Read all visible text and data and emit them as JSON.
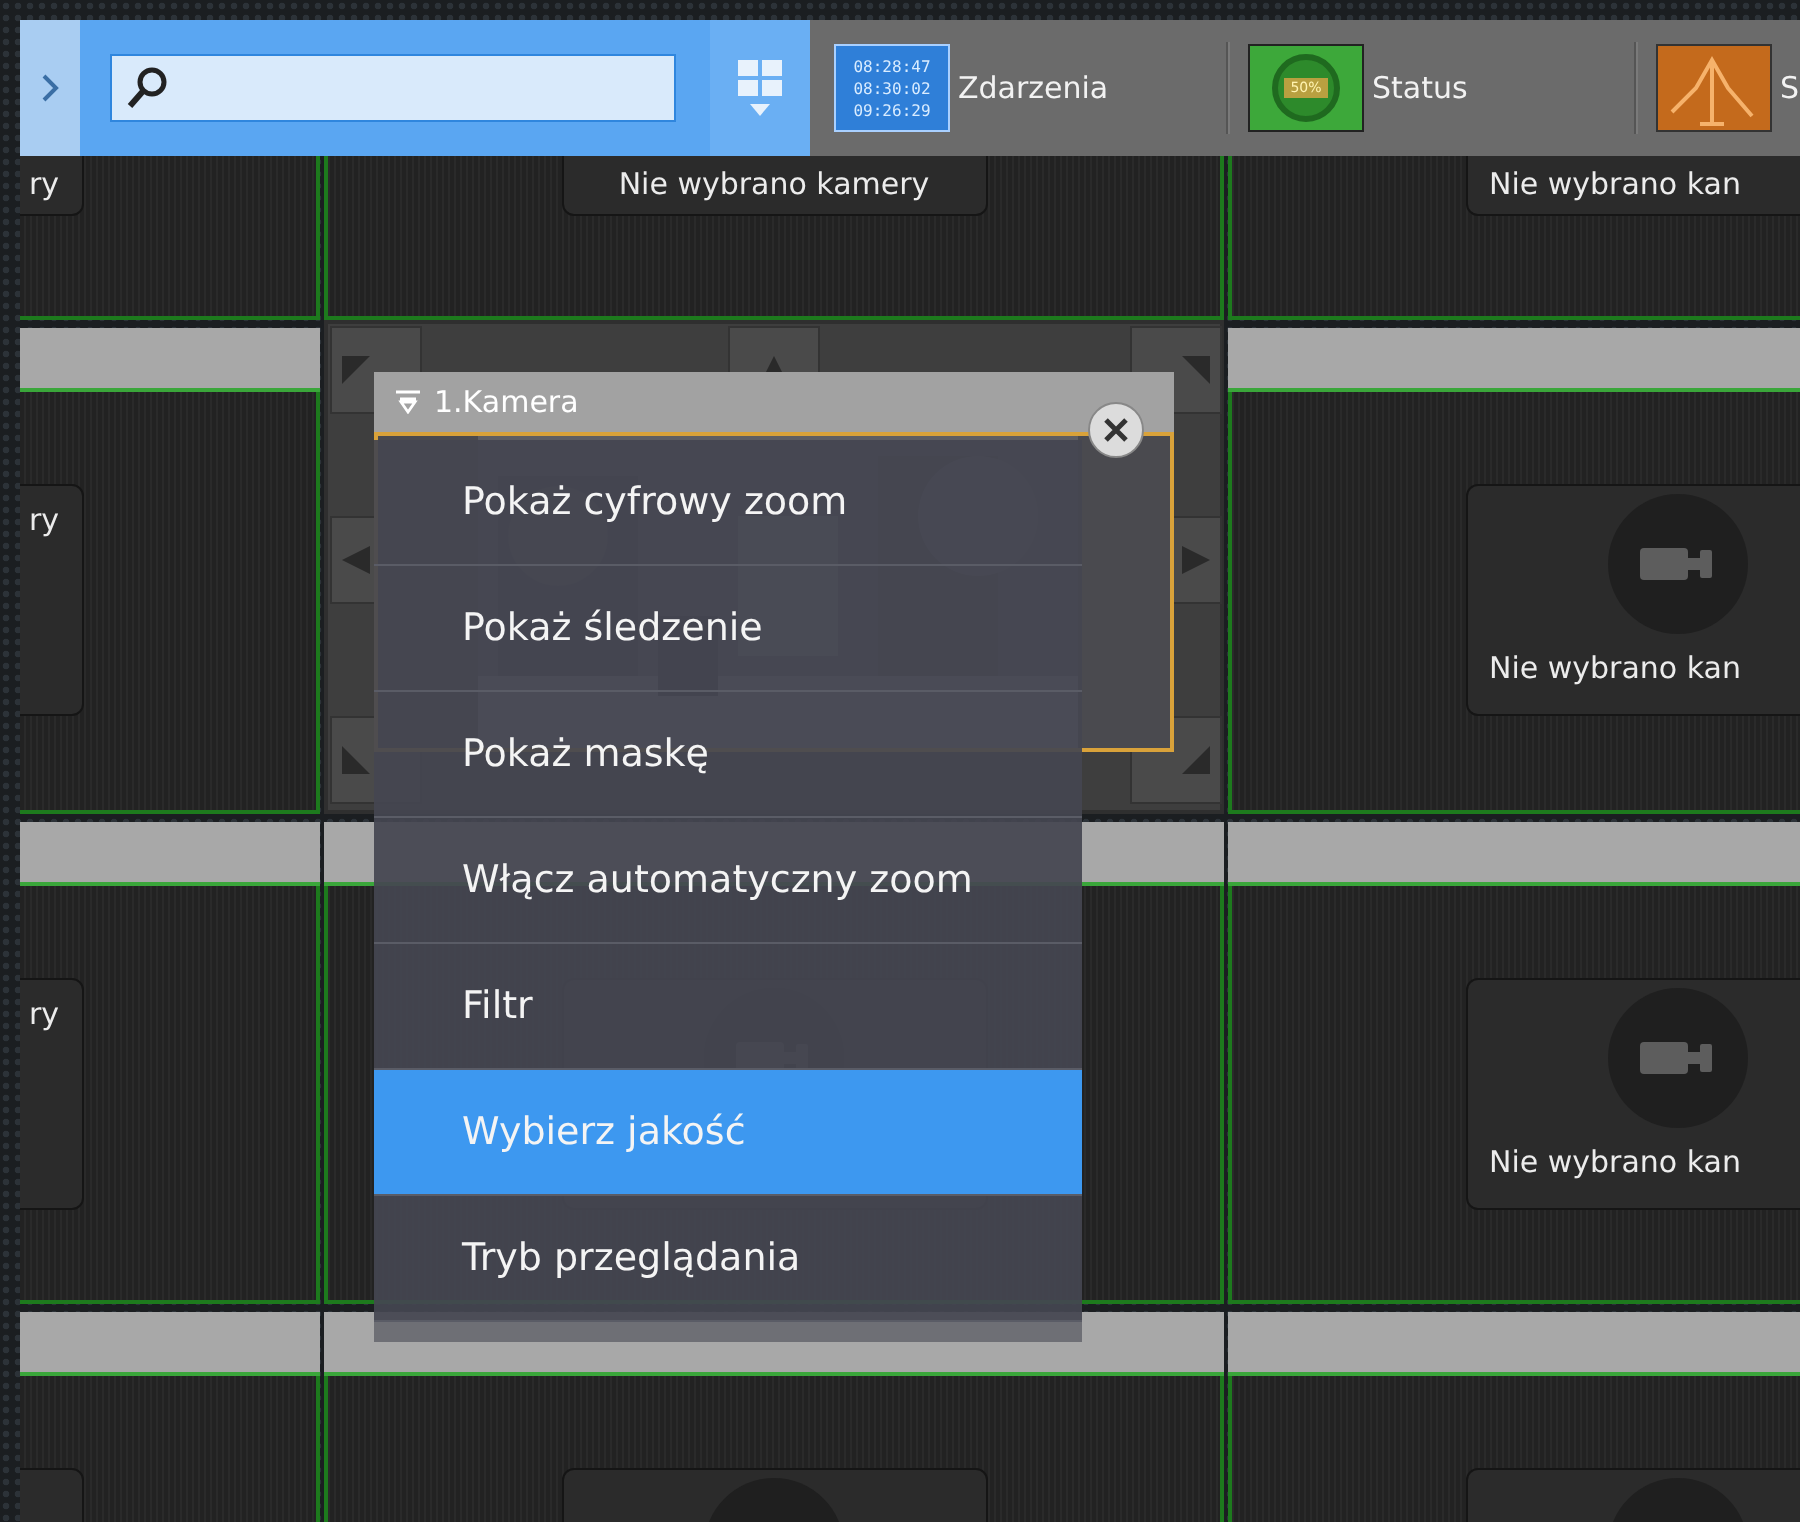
{
  "toolbar": {
    "tools": [
      {
        "kind": "events",
        "label": "Zdarzenia",
        "times": [
          "08:28:47",
          "08:30:02",
          "09:26:29"
        ]
      },
      {
        "kind": "status",
        "label": "Status",
        "badge": "50%"
      },
      {
        "kind": "graph",
        "label": "S"
      }
    ]
  },
  "grid": {
    "rows": [
      {
        "kind": "top",
        "cells": [
          {
            "kind": "empty",
            "label": "ry"
          },
          {
            "kind": "empty",
            "label": "Nie wybrano kamery"
          },
          {
            "kind": "empty",
            "label": "Nie wybrano kan"
          }
        ]
      },
      {
        "kind": "full",
        "cells": [
          {
            "kind": "empty",
            "label": "ry"
          },
          {
            "kind": "ptz"
          },
          {
            "kind": "empty",
            "label": "Nie wybrano kan"
          }
        ]
      },
      {
        "kind": "full",
        "cells": [
          {
            "kind": "empty",
            "label": "ry"
          },
          {
            "kind": "empty"
          },
          {
            "kind": "empty",
            "label": "Nie wybrano kan"
          }
        ]
      },
      {
        "kind": "bottom",
        "cells": [
          {
            "kind": "empty"
          },
          {
            "kind": "empty"
          },
          {
            "kind": "empty"
          }
        ]
      }
    ]
  },
  "popup": {
    "title": "1.Kamera",
    "items": [
      {
        "label": "Pokaż cyfrowy zoom",
        "selected": false
      },
      {
        "label": "Pokaż śledzenie",
        "selected": false
      },
      {
        "label": "Pokaż maskę",
        "selected": false
      },
      {
        "label": "Włącz automatyczny zoom",
        "selected": false
      },
      {
        "label": "Filtr",
        "selected": false
      },
      {
        "label": "Wybierz jakość",
        "selected": true
      },
      {
        "label": "Tryb przeglądania",
        "selected": false
      }
    ]
  }
}
